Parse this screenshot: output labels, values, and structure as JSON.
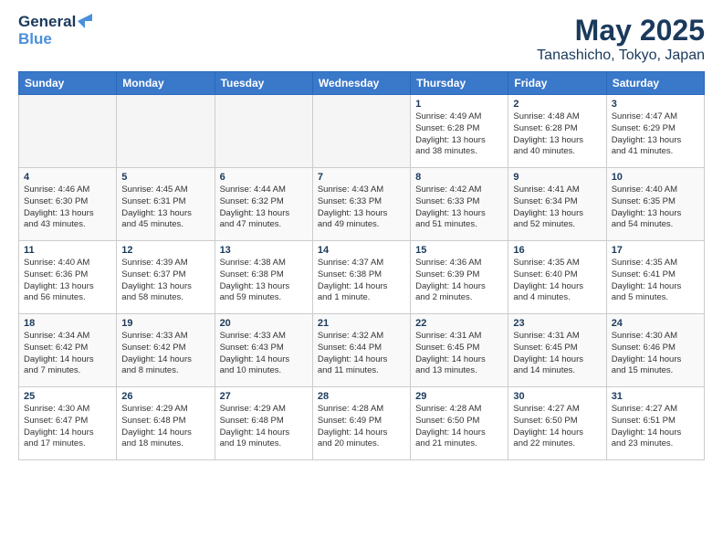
{
  "header": {
    "logo_line1": "General",
    "logo_line2": "Blue",
    "month_title": "May 2025",
    "location": "Tanashicho, Tokyo, Japan"
  },
  "days_of_week": [
    "Sunday",
    "Monday",
    "Tuesday",
    "Wednesday",
    "Thursday",
    "Friday",
    "Saturday"
  ],
  "weeks": [
    [
      {
        "day": "",
        "info": ""
      },
      {
        "day": "",
        "info": ""
      },
      {
        "day": "",
        "info": ""
      },
      {
        "day": "",
        "info": ""
      },
      {
        "day": "1",
        "info": "Sunrise: 4:49 AM\nSunset: 6:28 PM\nDaylight: 13 hours\nand 38 minutes."
      },
      {
        "day": "2",
        "info": "Sunrise: 4:48 AM\nSunset: 6:28 PM\nDaylight: 13 hours\nand 40 minutes."
      },
      {
        "day": "3",
        "info": "Sunrise: 4:47 AM\nSunset: 6:29 PM\nDaylight: 13 hours\nand 41 minutes."
      }
    ],
    [
      {
        "day": "4",
        "info": "Sunrise: 4:46 AM\nSunset: 6:30 PM\nDaylight: 13 hours\nand 43 minutes."
      },
      {
        "day": "5",
        "info": "Sunrise: 4:45 AM\nSunset: 6:31 PM\nDaylight: 13 hours\nand 45 minutes."
      },
      {
        "day": "6",
        "info": "Sunrise: 4:44 AM\nSunset: 6:32 PM\nDaylight: 13 hours\nand 47 minutes."
      },
      {
        "day": "7",
        "info": "Sunrise: 4:43 AM\nSunset: 6:33 PM\nDaylight: 13 hours\nand 49 minutes."
      },
      {
        "day": "8",
        "info": "Sunrise: 4:42 AM\nSunset: 6:33 PM\nDaylight: 13 hours\nand 51 minutes."
      },
      {
        "day": "9",
        "info": "Sunrise: 4:41 AM\nSunset: 6:34 PM\nDaylight: 13 hours\nand 52 minutes."
      },
      {
        "day": "10",
        "info": "Sunrise: 4:40 AM\nSunset: 6:35 PM\nDaylight: 13 hours\nand 54 minutes."
      }
    ],
    [
      {
        "day": "11",
        "info": "Sunrise: 4:40 AM\nSunset: 6:36 PM\nDaylight: 13 hours\nand 56 minutes."
      },
      {
        "day": "12",
        "info": "Sunrise: 4:39 AM\nSunset: 6:37 PM\nDaylight: 13 hours\nand 58 minutes."
      },
      {
        "day": "13",
        "info": "Sunrise: 4:38 AM\nSunset: 6:38 PM\nDaylight: 13 hours\nand 59 minutes."
      },
      {
        "day": "14",
        "info": "Sunrise: 4:37 AM\nSunset: 6:38 PM\nDaylight: 14 hours\nand 1 minute."
      },
      {
        "day": "15",
        "info": "Sunrise: 4:36 AM\nSunset: 6:39 PM\nDaylight: 14 hours\nand 2 minutes."
      },
      {
        "day": "16",
        "info": "Sunrise: 4:35 AM\nSunset: 6:40 PM\nDaylight: 14 hours\nand 4 minutes."
      },
      {
        "day": "17",
        "info": "Sunrise: 4:35 AM\nSunset: 6:41 PM\nDaylight: 14 hours\nand 5 minutes."
      }
    ],
    [
      {
        "day": "18",
        "info": "Sunrise: 4:34 AM\nSunset: 6:42 PM\nDaylight: 14 hours\nand 7 minutes."
      },
      {
        "day": "19",
        "info": "Sunrise: 4:33 AM\nSunset: 6:42 PM\nDaylight: 14 hours\nand 8 minutes."
      },
      {
        "day": "20",
        "info": "Sunrise: 4:33 AM\nSunset: 6:43 PM\nDaylight: 14 hours\nand 10 minutes."
      },
      {
        "day": "21",
        "info": "Sunrise: 4:32 AM\nSunset: 6:44 PM\nDaylight: 14 hours\nand 11 minutes."
      },
      {
        "day": "22",
        "info": "Sunrise: 4:31 AM\nSunset: 6:45 PM\nDaylight: 14 hours\nand 13 minutes."
      },
      {
        "day": "23",
        "info": "Sunrise: 4:31 AM\nSunset: 6:45 PM\nDaylight: 14 hours\nand 14 minutes."
      },
      {
        "day": "24",
        "info": "Sunrise: 4:30 AM\nSunset: 6:46 PM\nDaylight: 14 hours\nand 15 minutes."
      }
    ],
    [
      {
        "day": "25",
        "info": "Sunrise: 4:30 AM\nSunset: 6:47 PM\nDaylight: 14 hours\nand 17 minutes."
      },
      {
        "day": "26",
        "info": "Sunrise: 4:29 AM\nSunset: 6:48 PM\nDaylight: 14 hours\nand 18 minutes."
      },
      {
        "day": "27",
        "info": "Sunrise: 4:29 AM\nSunset: 6:48 PM\nDaylight: 14 hours\nand 19 minutes."
      },
      {
        "day": "28",
        "info": "Sunrise: 4:28 AM\nSunset: 6:49 PM\nDaylight: 14 hours\nand 20 minutes."
      },
      {
        "day": "29",
        "info": "Sunrise: 4:28 AM\nSunset: 6:50 PM\nDaylight: 14 hours\nand 21 minutes."
      },
      {
        "day": "30",
        "info": "Sunrise: 4:27 AM\nSunset: 6:50 PM\nDaylight: 14 hours\nand 22 minutes."
      },
      {
        "day": "31",
        "info": "Sunrise: 4:27 AM\nSunset: 6:51 PM\nDaylight: 14 hours\nand 23 minutes."
      }
    ]
  ]
}
